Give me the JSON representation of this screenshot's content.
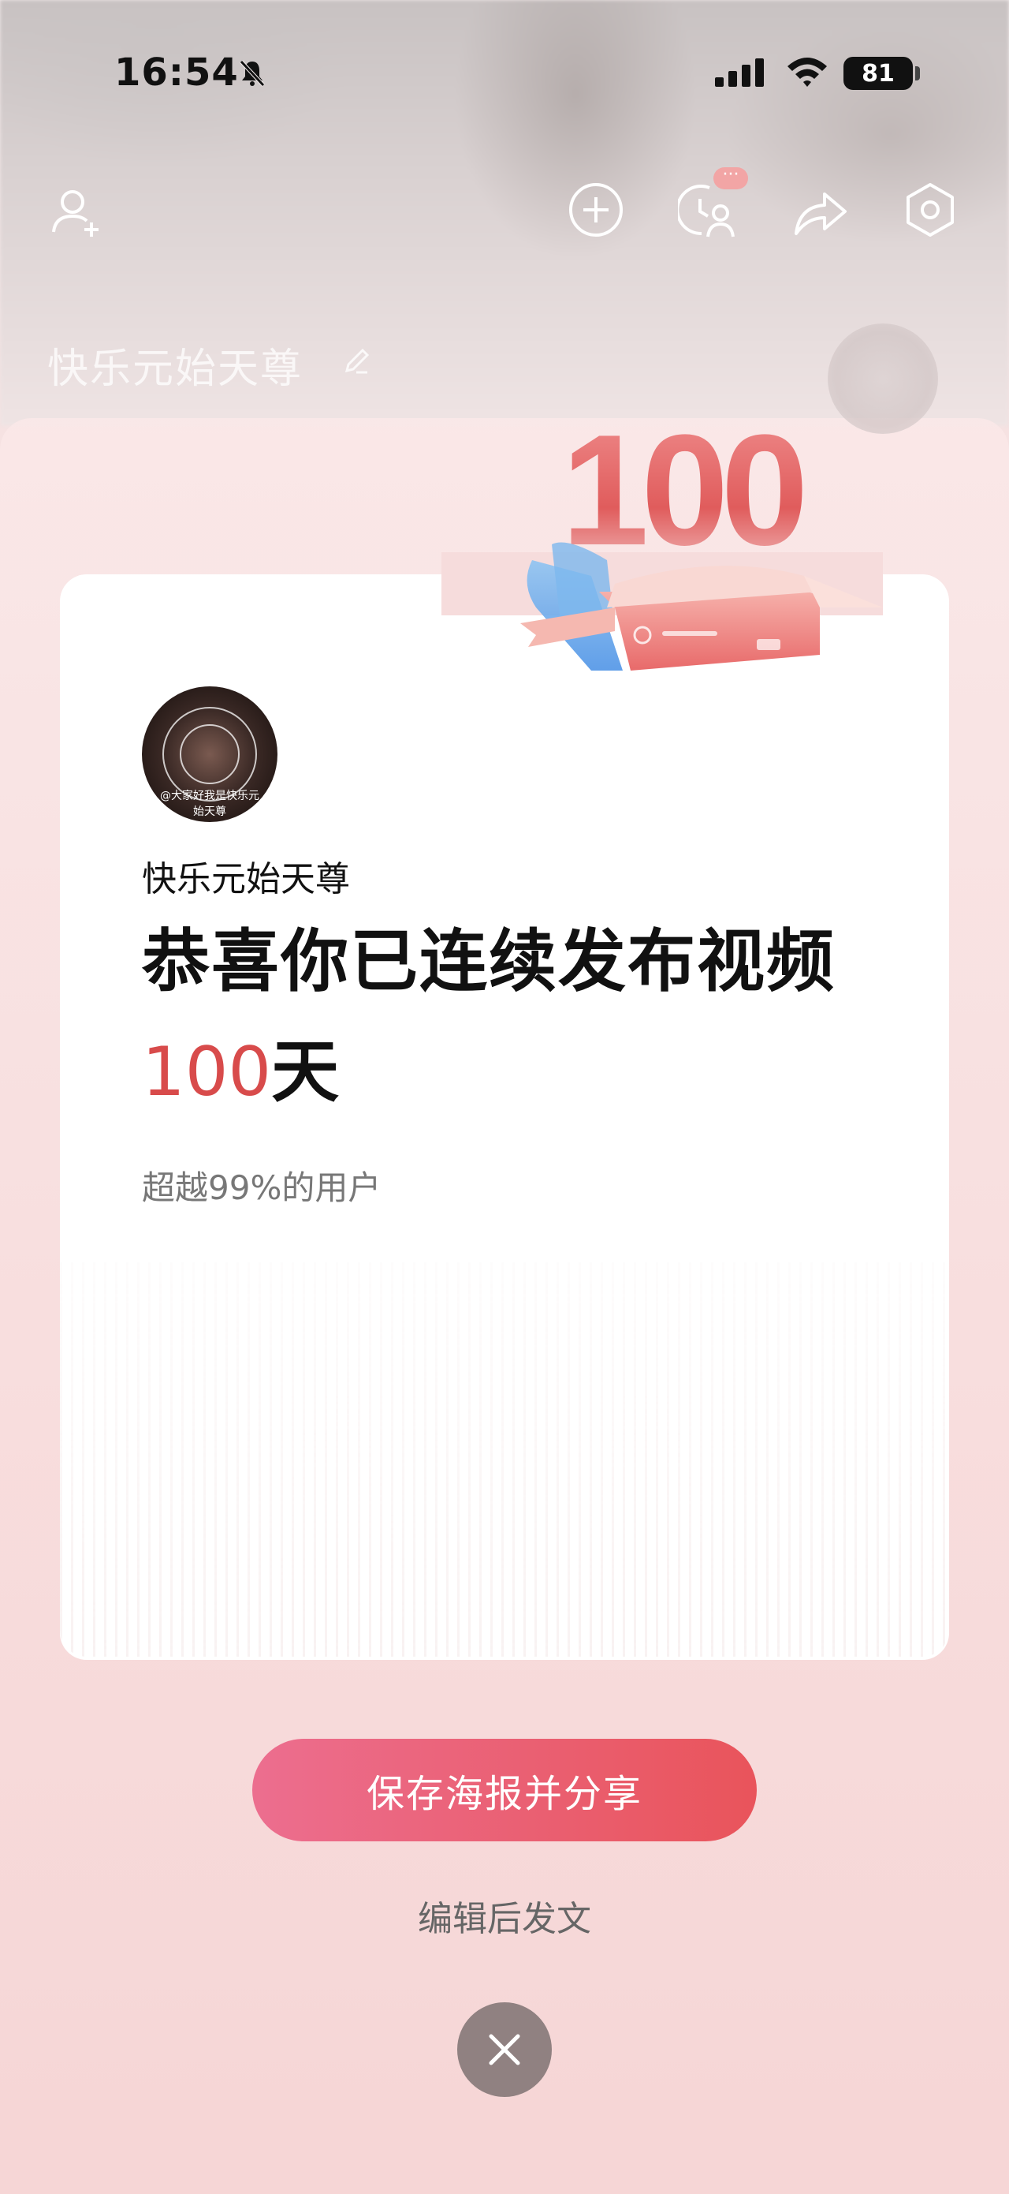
{
  "status_bar": {
    "time": "16:54",
    "battery": "81"
  },
  "header": {
    "more_badge": "···"
  },
  "profile": {
    "name": "快乐元始天尊"
  },
  "card": {
    "user_name": "快乐元始天尊",
    "headline_line1": "恭喜你已连续发布视频",
    "days_value": "100",
    "days_unit": "天",
    "subtext": "超越99%的用户",
    "avatar_caption_1": "@大家好我是快乐元",
    "avatar_caption_2": "始天尊"
  },
  "badge": {
    "number": "100"
  },
  "actions": {
    "save_label": "保存海报并分享",
    "edit_label": "编辑后发文"
  },
  "colors": {
    "accent": "#e9545b",
    "days_red": "#d84b4b"
  }
}
